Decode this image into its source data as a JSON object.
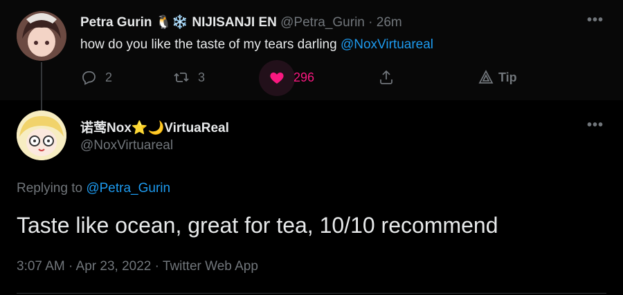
{
  "parent": {
    "display_name": "Petra Gurin",
    "name_emojis": "🐧❄️",
    "name_suffix": "NIJISANJI EN",
    "handle": "@Petra_Gurin",
    "separator": "·",
    "time": "26m",
    "text": "how do you like the taste of my tears darling",
    "mention": "@NoxVirtuareal",
    "actions": {
      "reply_count": "2",
      "retweet_count": "3",
      "like_count": "296",
      "tip_label": "Tip"
    }
  },
  "reply": {
    "display_name": "诺莺Nox",
    "name_emojis": "⭐🌙",
    "name_suffix": "VirtuaReal",
    "handle": "@NoxVirtuareal",
    "replying_to_label": "Replying to",
    "replying_to_handle": "@Petra_Gurin",
    "text": "Taste like ocean, great for tea, 10/10 recommend",
    "timestamp": "3:07 AM · Apr 23, 2022 · Twitter Web App"
  },
  "menu_label": "•••",
  "colors": {
    "background": "#000000",
    "parent_background": "#080808",
    "text": "#e7e9ea",
    "muted": "#71767b",
    "link": "#1d9bf0",
    "like": "#f91880"
  }
}
